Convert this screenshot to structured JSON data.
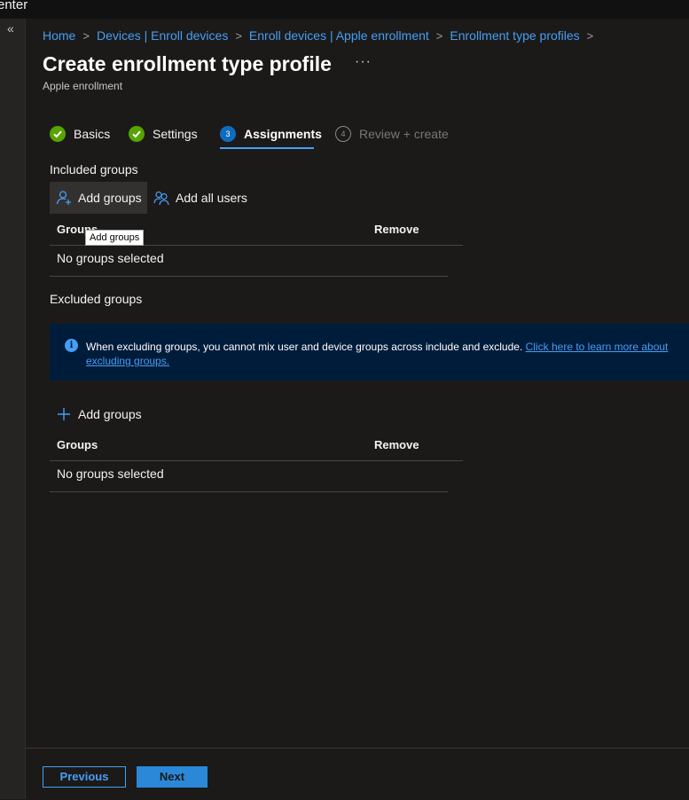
{
  "window": {
    "title_fragment": "enter"
  },
  "breadcrumb": [
    {
      "label": "Home"
    },
    {
      "label": "Devices | Enroll devices"
    },
    {
      "label": "Enroll devices | Apple enrollment"
    },
    {
      "label": "Enrollment type profiles"
    }
  ],
  "page": {
    "title": "Create enrollment type profile",
    "subtitle": "Apple enrollment",
    "more_glyph": "···"
  },
  "wizard": {
    "steps": [
      {
        "label": "Basics",
        "state": "done",
        "number": "1"
      },
      {
        "label": "Settings",
        "state": "done",
        "number": "2"
      },
      {
        "label": "Assignments",
        "state": "active",
        "number": "3"
      },
      {
        "label": "Review + create",
        "state": "pending",
        "number": "4"
      }
    ]
  },
  "included": {
    "label": "Included groups",
    "add_groups": "Add groups",
    "add_all_users": "Add all users",
    "tooltip": "Add groups",
    "columns": {
      "groups": "Groups",
      "remove": "Remove"
    },
    "empty": "No groups selected"
  },
  "excluded": {
    "label": "Excluded groups",
    "info": "When excluding groups, you cannot mix user and device groups across include and exclude.",
    "info_link": "Click here to learn more about excluding groups.",
    "add_groups": "Add groups",
    "columns": {
      "groups": "Groups",
      "remove": "Remove"
    },
    "empty": "No groups selected"
  },
  "footer": {
    "previous": "Previous",
    "next": "Next"
  },
  "colors": {
    "accent": "#479ef5",
    "done": "#57a300",
    "info_bg": "#001c3b",
    "primary_button": "#2b88d8"
  }
}
